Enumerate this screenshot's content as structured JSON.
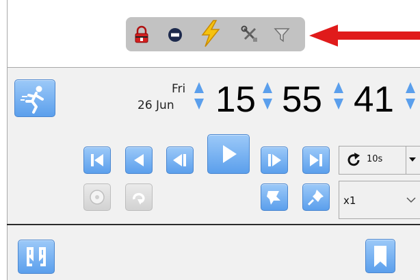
{
  "toolbar": {
    "icons": [
      "lock-icon",
      "record-stop-icon",
      "lightning-icon",
      "tools-icon",
      "filter-icon"
    ]
  },
  "timestamp": {
    "weekday": "Fri",
    "date": "26 Jun",
    "hours": "15",
    "minutes": "55",
    "seconds": "41"
  },
  "controls": {
    "skip_interval": "10s",
    "speed": "x1"
  },
  "colors": {
    "accent_blue": "#5b9fec",
    "arrow_red": "#e01b1b",
    "toolbar_bg": "#c2c2c2",
    "panel_bg": "#f1f1f1"
  }
}
